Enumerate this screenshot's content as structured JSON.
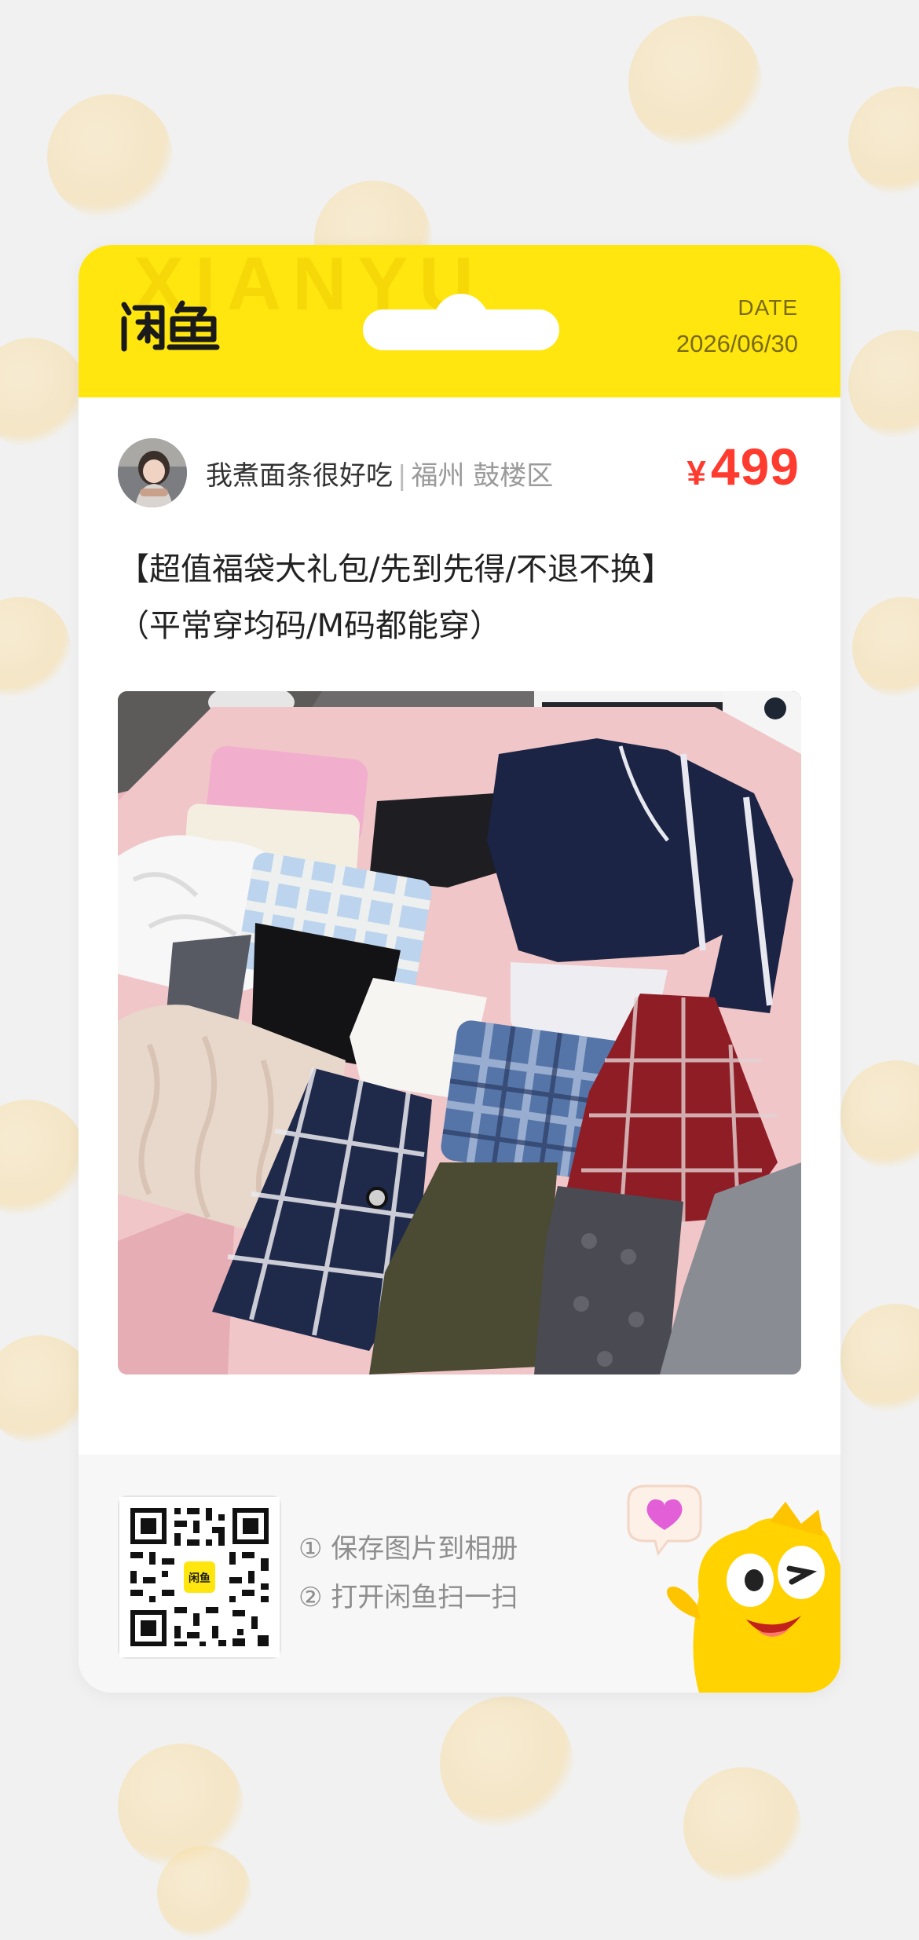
{
  "header": {
    "brand_logo": "闲鱼",
    "watermark": "XIANYU",
    "date_label": "DATE",
    "date_value": "2026/06/30"
  },
  "seller": {
    "name": "我煮面条很好吃",
    "separator": "|",
    "location": "福州 鼓楼区"
  },
  "price": {
    "currency": "¥",
    "amount": "499",
    "color": "#ff3b2f"
  },
  "listing": {
    "title_line1": "【超值福袋大礼包/先到先得/不退不换】",
    "title_line2": "（平常穿均码/M码都能穿）",
    "photo_subject": "clothing-bundle-on-pink-bed"
  },
  "footer": {
    "step1": "① 保存图片到相册",
    "step2": "② 打开闲鱼扫一扫",
    "qr_center_logo": "闲鱼"
  },
  "colors": {
    "brand_yellow": "#ffe60f",
    "page_bg": "#f1f1f1"
  },
  "icons": [
    "xianyu-logo",
    "qr-code-icon",
    "heart-bubble-icon",
    "mascot-fish"
  ]
}
